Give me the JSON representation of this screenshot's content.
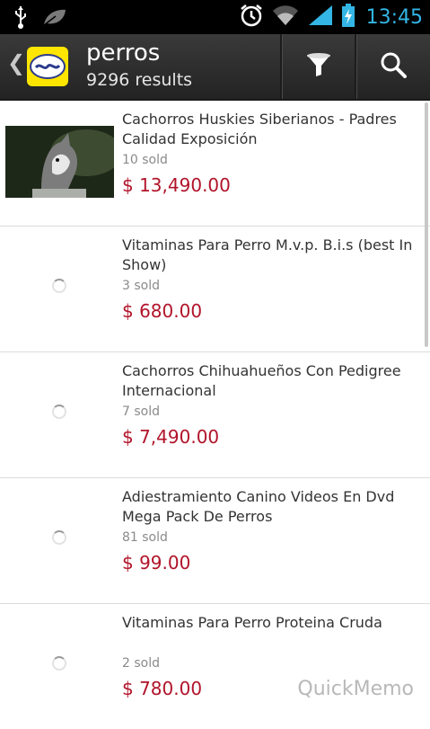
{
  "status_bar": {
    "time": "13:45",
    "icons": [
      "usb-icon",
      "leaf-icon",
      "alarm-icon",
      "wifi-icon",
      "signal-icon",
      "battery-charging-icon"
    ],
    "accent": "#33b5e5"
  },
  "action_bar": {
    "title": "perros",
    "subtitle": "9296 results",
    "logo_color": "#ffe600",
    "buttons": [
      "filter-icon",
      "search-icon"
    ]
  },
  "results": [
    {
      "title": "Cachorros Huskies Siberianos - Padres Calidad Exposición",
      "sold": "10 sold",
      "price": "$ 13,490.00",
      "has_image": true
    },
    {
      "title": "Vitaminas Para Perro M.v.p. B.i.s (best In Show)",
      "sold": "3 sold",
      "price": "$ 680.00",
      "has_image": false
    },
    {
      "title": "Cachorros Chihuahueños Con Pedigree Internacional",
      "sold": "7 sold",
      "price": "$ 7,490.00",
      "has_image": false
    },
    {
      "title": "Adiestramiento Canino Videos En Dvd Mega Pack De Perros",
      "sold": "81 sold",
      "price": "$ 99.00",
      "has_image": false
    },
    {
      "title": "Vitaminas Para Perro Proteina Cruda",
      "sold": "2 sold",
      "price": "$ 780.00",
      "has_image": false
    }
  ],
  "price_color": "#b1142a",
  "watermark": "QuickMemo"
}
